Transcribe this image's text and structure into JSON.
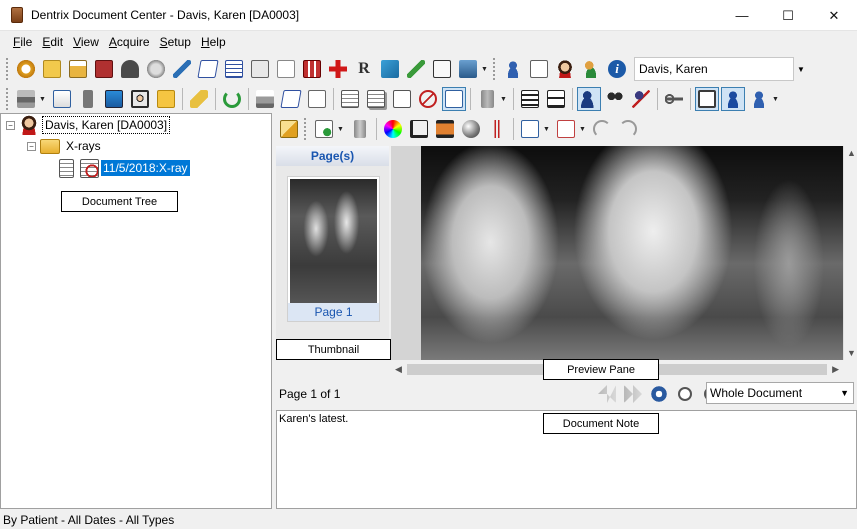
{
  "window": {
    "title": "Dentrix Document Center - Davis, Karen [DA0003]",
    "minimize_glyph": "—",
    "maximize_glyph": "☐",
    "close_glyph": "✕"
  },
  "menu": {
    "items": [
      {
        "label": "File",
        "accel": "F",
        "rest": "ile"
      },
      {
        "label": "Edit",
        "accel": "E",
        "rest": "dit"
      },
      {
        "label": "View",
        "accel": "V",
        "rest": "iew"
      },
      {
        "label": "Acquire",
        "accel": "A",
        "rest": "cquire"
      },
      {
        "label": "Setup",
        "accel": "S",
        "rest": "etup"
      },
      {
        "label": "Help",
        "accel": "H",
        "rest": "elp"
      }
    ]
  },
  "toolbar": {
    "patient_name": "Davis, Karen"
  },
  "tree": {
    "root_label": "Davis, Karen [DA0003]",
    "folder_label": "X-rays",
    "document_label": "11/5/2018:X-ray",
    "callout": "Document Tree"
  },
  "pages": {
    "header": "Page(s)",
    "thumb_label": "Page 1",
    "callout": "Thumbnail"
  },
  "preview": {
    "callout": "Preview Pane"
  },
  "pager": {
    "page_text": "Page 1 of 1",
    "zoom_value": "Whole Document"
  },
  "note": {
    "text": "Karen's latest.",
    "callout": "Document Note"
  },
  "status": {
    "text": "By Patient - All Dates - All Types"
  }
}
